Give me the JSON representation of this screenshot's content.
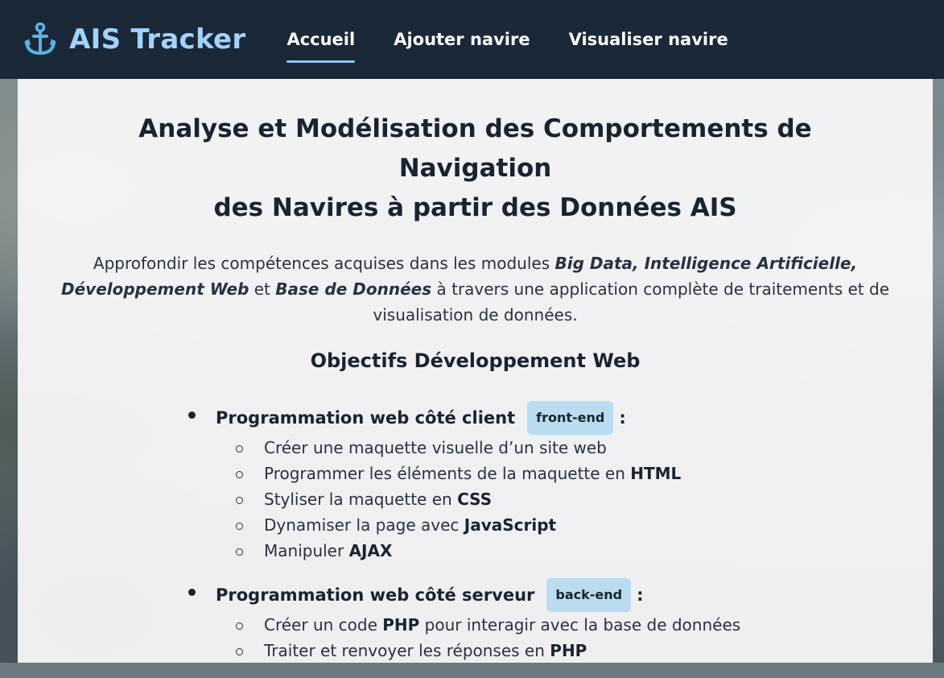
{
  "app": {
    "title": "AIS Tracker",
    "logo_icon": "anchor-icon",
    "brand_color": "#9fd4ff",
    "header_bg": "#1b2838"
  },
  "nav": {
    "items": [
      {
        "label": "Accueil",
        "active": true
      },
      {
        "label": "Ajouter navire",
        "active": false
      },
      {
        "label": "Visualiser navire",
        "active": false
      }
    ]
  },
  "main": {
    "title_line1": "Analyse et Modélisation des Comportements de",
    "title_line2": "Navigation",
    "title_line3": "des Navires à partir des Données AIS",
    "intro": {
      "t1": "Approfondir les compétences acquises dans les modules ",
      "b1": "Big Data, Intelligence Artificielle, Développement Web",
      "t2": " et ",
      "b2": "Base de Données",
      "t3": " à travers une application complète de traitements et de visualisation de données."
    },
    "section_title": "Objectifs Développement Web",
    "objectives": [
      {
        "label": "Programmation web côté client",
        "tag": "front-end",
        "suffix": ":",
        "items": [
          {
            "text": "Créer une maquette visuelle d’un site web",
            "bold": ""
          },
          {
            "text": "Programmer les éléments de la maquette en ",
            "bold": "HTML"
          },
          {
            "text": "Styliser la maquette en ",
            "bold": "CSS"
          },
          {
            "text": "Dynamiser la page avec ",
            "bold": "JavaScript"
          },
          {
            "text": "Manipuler ",
            "bold": "AJAX"
          }
        ]
      },
      {
        "label": "Programmation web côté serveur",
        "tag": "back-end",
        "suffix": ":",
        "items": [
          {
            "text": "Créer un code ",
            "bold": "PHP",
            "after": " pour interagir avec la base de données"
          },
          {
            "text": "Traiter et renvoyer les réponses en ",
            "bold": "PHP"
          }
        ]
      }
    ]
  }
}
